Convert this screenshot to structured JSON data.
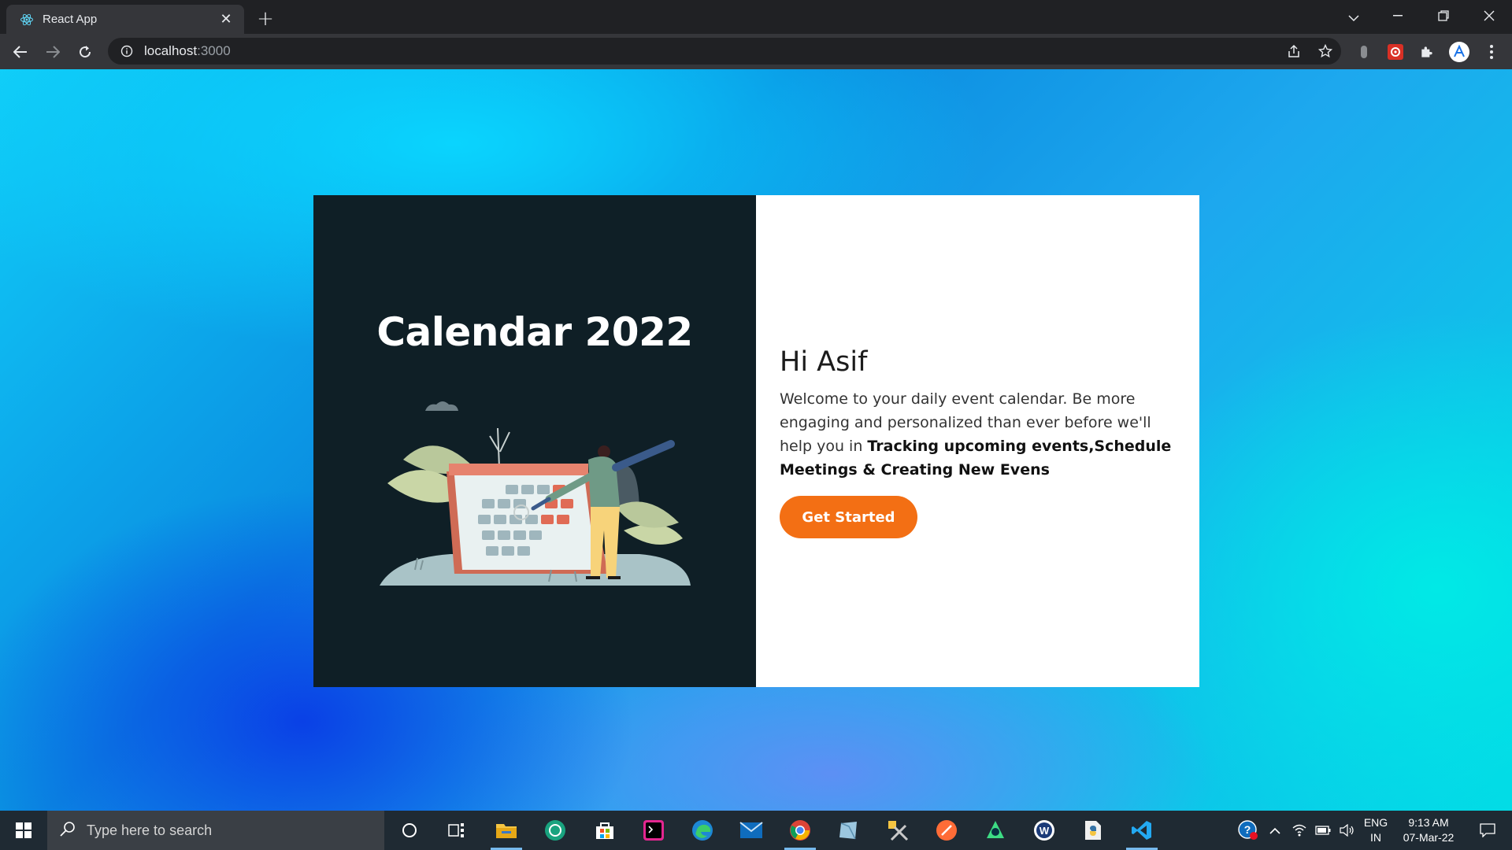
{
  "browser": {
    "tab_title": "React App",
    "url_host": "localhost",
    "url_port": ":3000"
  },
  "page": {
    "hero_title": "Calendar 2022",
    "greeting": "Hi Asif",
    "description_plain": "Welcome to your daily event calendar. Be more engaging and personalized than ever before we'll help you in ",
    "description_bold": "Tracking upcoming events,Schedule Meetings & Creating New Evens",
    "cta_label": "Get Started"
  },
  "taskbar": {
    "search_placeholder": "Type here to search",
    "lang_line1": "ENG",
    "lang_line2": "IN",
    "time": "9:13 AM",
    "date": "07-Mar-22",
    "apps": [
      "cortana-icon",
      "task-view-icon",
      "file-explorer-icon",
      "chatgpt-icon",
      "microsoft-store-icon",
      "terminal-icon",
      "edge-icon",
      "mail-icon",
      "chrome-icon",
      "app-icon",
      "tools-icon",
      "postman-icon",
      "android-studio-icon",
      "word-icon",
      "python-icon",
      "vscode-icon"
    ]
  },
  "colors": {
    "accent": "#f36f14",
    "card_dark": "#0f1f26"
  }
}
